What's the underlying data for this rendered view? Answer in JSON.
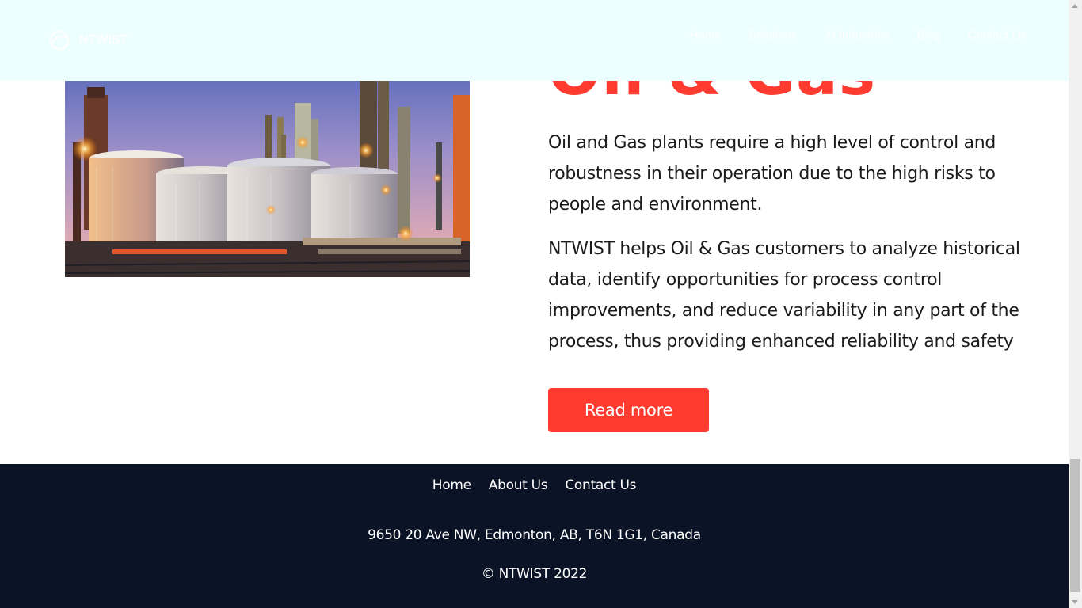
{
  "header": {
    "logo_text": "NTWIST",
    "nav": [
      "Home",
      "Solutions",
      "AI Industries",
      "Blog",
      "Contact Us"
    ]
  },
  "section": {
    "title": "Oil & Gas",
    "paragraphs": [
      "Oil and Gas plants require a high level of control and robustness in their operation due to the high risks to people and environment.",
      "NTWIST helps Oil & Gas customers to analyze historical data, identify opportunities for process control improvements, and reduce variability in any part of the process, thus providing enhanced reliability and safety"
    ],
    "cta_label": "Read more"
  },
  "footer": {
    "links": [
      "Home",
      "About Us",
      "Contact Us"
    ],
    "address": "9650 20 Ave NW, Edmonton, AB, T6N 1G1, Canada",
    "copyright": "© NTWIST 2022"
  },
  "colors": {
    "accent": "#ff3b30",
    "header_bg": "#ecfefe",
    "footer_bg": "#0b1426"
  }
}
